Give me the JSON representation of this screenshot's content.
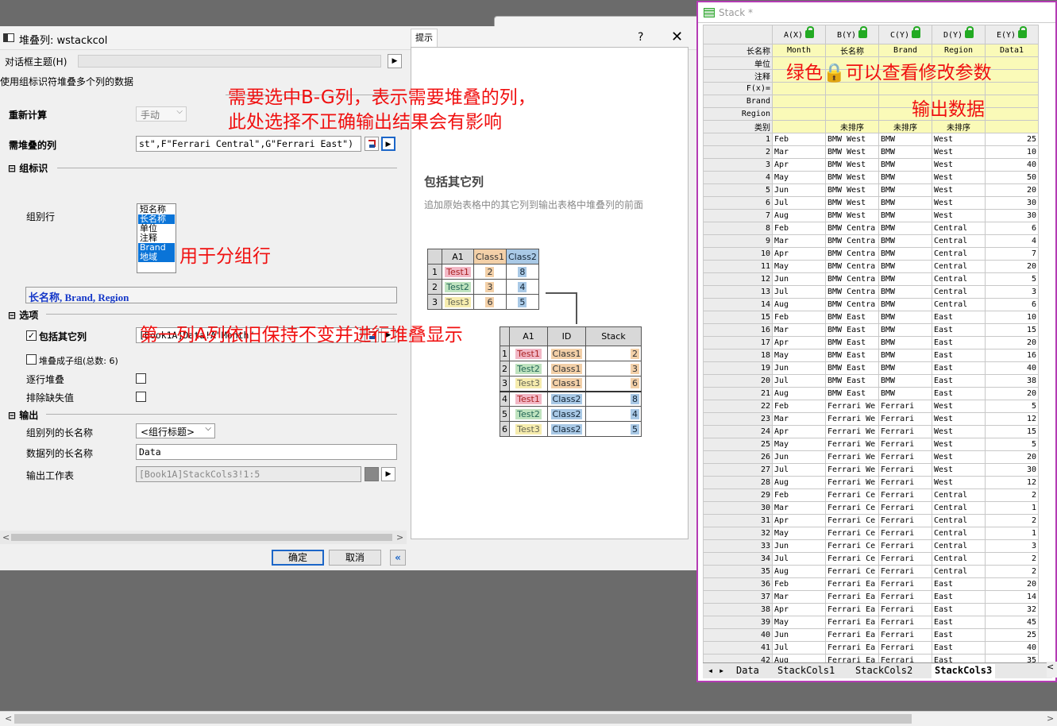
{
  "dialog": {
    "title": "堆叠列: wstackcol",
    "help": "?",
    "close": "✕",
    "theme_label": "对话框主题(H)",
    "description": "使用组标识符堆叠多个列的数据",
    "recalc_label": "重新计算",
    "recalc_value": "手动",
    "cols_label": "需堆叠的列",
    "cols_value": "st\",F\"Ferrari Central\",G\"Ferrari East\")",
    "group_section": "组标识",
    "group_rows_label": "组别行",
    "group_rows_options": [
      {
        "label": "短名称",
        "selected": false
      },
      {
        "label": "长名称",
        "selected": true
      },
      {
        "label": "单位",
        "selected": false
      },
      {
        "label": "注释",
        "selected": false
      },
      {
        "label": "Brand",
        "selected": true
      },
      {
        "label": "地域",
        "selected": true
      }
    ],
    "group_summary": "长名称, Brand, Region",
    "options_section": "选项",
    "include_other_label": "包括其它列",
    "include_other_checked": true,
    "include_other_value": "[Book1A]Data!A\"Month\"",
    "subgroup_label": "堆叠成子组(总数: 6)",
    "row_by_row_label": "逐行堆叠",
    "exclude_missing_label": "排除缺失值",
    "output_section": "输出",
    "group_col_name_label": "组别列的长名称",
    "group_col_name_value": "<组行标题>",
    "data_col_name_label": "数据列的长名称",
    "data_col_name_value": "Data",
    "output_sheet_label": "输出工作表",
    "output_sheet_value": "[Book1A]StackCols3!1:5",
    "ok": "确定",
    "cancel": "取消",
    "collapse": "«"
  },
  "hint": {
    "tab": "提示",
    "title": "包括其它列",
    "desc": "追加原始表格中的其它列到输出表格中堆叠列的前面",
    "src_headers": [
      "A1",
      "Class1",
      "Class2"
    ],
    "src_rows": [
      [
        "1",
        "Test1",
        "2",
        "8"
      ],
      [
        "2",
        "Test2",
        "3",
        "4"
      ],
      [
        "3",
        "Test3",
        "6",
        "5"
      ]
    ],
    "out_headers": [
      "A1",
      "ID",
      "Stack"
    ],
    "out_rows": [
      [
        "1",
        "Test1",
        "Class1",
        "2"
      ],
      [
        "2",
        "Test2",
        "Class1",
        "3"
      ],
      [
        "3",
        "Test3",
        "Class1",
        "6"
      ],
      [
        "4",
        "Test1",
        "Class2",
        "8"
      ],
      [
        "5",
        "Test2",
        "Class2",
        "4"
      ],
      [
        "6",
        "Test3",
        "Class2",
        "5"
      ]
    ]
  },
  "sheet": {
    "title": "Stack *",
    "col_headers": [
      "A(X)",
      "B(Y)",
      "C(Y)",
      "D(Y)",
      "E(Y)"
    ],
    "meta_rows": [
      {
        "label": "长名称",
        "cells": [
          "Month",
          "长名称",
          "Brand",
          "Region",
          "Data1"
        ]
      },
      {
        "label": "单位",
        "cells": [
          "",
          "",
          "",
          "",
          ""
        ]
      },
      {
        "label": "注释",
        "cells": [
          "",
          "",
          "",
          "",
          ""
        ]
      },
      {
        "label": "F(x)=",
        "cells": [
          "",
          "",
          "",
          "",
          ""
        ]
      },
      {
        "label": "Brand",
        "cells": [
          "",
          "",
          "",
          "",
          ""
        ]
      },
      {
        "label": "Region",
        "cells": [
          "",
          "",
          "",
          "",
          ""
        ]
      },
      {
        "label": "类别",
        "cells": [
          "",
          "未排序",
          "未排序",
          "未排序",
          ""
        ]
      }
    ],
    "rows": [
      [
        "1",
        "Feb",
        "BMW West",
        "BMW",
        "West",
        "25"
      ],
      [
        "2",
        "Mar",
        "BMW West",
        "BMW",
        "West",
        "10"
      ],
      [
        "3",
        "Apr",
        "BMW West",
        "BMW",
        "West",
        "40"
      ],
      [
        "4",
        "May",
        "BMW West",
        "BMW",
        "West",
        "50"
      ],
      [
        "5",
        "Jun",
        "BMW West",
        "BMW",
        "West",
        "20"
      ],
      [
        "6",
        "Jul",
        "BMW West",
        "BMW",
        "West",
        "30"
      ],
      [
        "7",
        "Aug",
        "BMW West",
        "BMW",
        "West",
        "30"
      ],
      [
        "8",
        "Feb",
        "BMW Centra",
        "BMW",
        "Central",
        "6"
      ],
      [
        "9",
        "Mar",
        "BMW Centra",
        "BMW",
        "Central",
        "4"
      ],
      [
        "10",
        "Apr",
        "BMW Centra",
        "BMW",
        "Central",
        "7"
      ],
      [
        "11",
        "May",
        "BMW Centra",
        "BMW",
        "Central",
        "20"
      ],
      [
        "12",
        "Jun",
        "BMW Centra",
        "BMW",
        "Central",
        "5"
      ],
      [
        "13",
        "Jul",
        "BMW Centra",
        "BMW",
        "Central",
        "3"
      ],
      [
        "14",
        "Aug",
        "BMW Centra",
        "BMW",
        "Central",
        "6"
      ],
      [
        "15",
        "Feb",
        "BMW East",
        "BMW",
        "East",
        "10"
      ],
      [
        "16",
        "Mar",
        "BMW East",
        "BMW",
        "East",
        "15"
      ],
      [
        "17",
        "Apr",
        "BMW East",
        "BMW",
        "East",
        "20"
      ],
      [
        "18",
        "May",
        "BMW East",
        "BMW",
        "East",
        "16"
      ],
      [
        "19",
        "Jun",
        "BMW East",
        "BMW",
        "East",
        "40"
      ],
      [
        "20",
        "Jul",
        "BMW East",
        "BMW",
        "East",
        "38"
      ],
      [
        "21",
        "Aug",
        "BMW East",
        "BMW",
        "East",
        "20"
      ],
      [
        "22",
        "Feb",
        "Ferrari We",
        "Ferrari",
        "West",
        "5"
      ],
      [
        "23",
        "Mar",
        "Ferrari We",
        "Ferrari",
        "West",
        "12"
      ],
      [
        "24",
        "Apr",
        "Ferrari We",
        "Ferrari",
        "West",
        "15"
      ],
      [
        "25",
        "May",
        "Ferrari We",
        "Ferrari",
        "West",
        "5"
      ],
      [
        "26",
        "Jun",
        "Ferrari We",
        "Ferrari",
        "West",
        "20"
      ],
      [
        "27",
        "Jul",
        "Ferrari We",
        "Ferrari",
        "West",
        "30"
      ],
      [
        "28",
        "Aug",
        "Ferrari We",
        "Ferrari",
        "West",
        "12"
      ],
      [
        "29",
        "Feb",
        "Ferrari Ce",
        "Ferrari",
        "Central",
        "2"
      ],
      [
        "30",
        "Mar",
        "Ferrari Ce",
        "Ferrari",
        "Central",
        "1"
      ],
      [
        "31",
        "Apr",
        "Ferrari Ce",
        "Ferrari",
        "Central",
        "2"
      ],
      [
        "32",
        "May",
        "Ferrari Ce",
        "Ferrari",
        "Central",
        "1"
      ],
      [
        "33",
        "Jun",
        "Ferrari Ce",
        "Ferrari",
        "Central",
        "3"
      ],
      [
        "34",
        "Jul",
        "Ferrari Ce",
        "Ferrari",
        "Central",
        "2"
      ],
      [
        "35",
        "Aug",
        "Ferrari Ce",
        "Ferrari",
        "Central",
        "2"
      ],
      [
        "36",
        "Feb",
        "Ferrari Ea",
        "Ferrari",
        "East",
        "20"
      ],
      [
        "37",
        "Mar",
        "Ferrari Ea",
        "Ferrari",
        "East",
        "14"
      ],
      [
        "38",
        "Apr",
        "Ferrari Ea",
        "Ferrari",
        "East",
        "32"
      ],
      [
        "39",
        "May",
        "Ferrari Ea",
        "Ferrari",
        "East",
        "45"
      ],
      [
        "40",
        "Jun",
        "Ferrari Ea",
        "Ferrari",
        "East",
        "25"
      ],
      [
        "41",
        "Jul",
        "Ferrari Ea",
        "Ferrari",
        "East",
        "40"
      ],
      [
        "42",
        "Aug",
        "Ferrari Ea",
        "Ferrari",
        "East",
        "35"
      ]
    ],
    "tabs": [
      "Data",
      "StackCols1",
      "StackCols2",
      "StackCols3"
    ],
    "active_tab": "StackCols3"
  },
  "annotations": {
    "cols_note_1": "需要选中B-G列，表示需要堆叠的列，",
    "cols_note_2": "此处选择不正确输出结果会有影响",
    "group_note": "用于分组行",
    "first_col_note": "第一列A列依旧保持不变并进行堆叠显示",
    "green_lock_note": "绿色🔒可以查看修改参数",
    "output_note": "输出数据"
  },
  "colors": {
    "annotation": "#f01010",
    "window_border": "#b43cb4",
    "meta_row_bg": "#fafab8",
    "selection": "#0a74d8"
  }
}
